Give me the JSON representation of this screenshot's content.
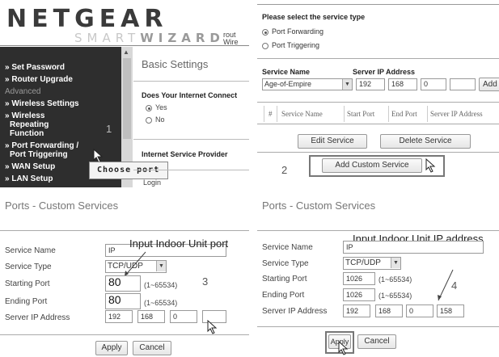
{
  "panel1": {
    "logo": "NETGEAR",
    "logo_sub_light": "SMART",
    "logo_sub_bold": "WIZARD",
    "logo_side_1": "rout",
    "logo_side_2": "Wire",
    "sidebar": {
      "items": [
        {
          "label": "» Set Password"
        },
        {
          "label": "» Router Upgrade"
        },
        {
          "label": "» Wireless Settings"
        },
        {
          "label": "» Wireless"
        },
        {
          "label": "Repeating"
        },
        {
          "label": "Function"
        },
        {
          "label": "» Port Forwarding /"
        },
        {
          "label": "Port Triggering"
        },
        {
          "label": "» WAN Setup"
        },
        {
          "label": "» LAN Setup"
        }
      ],
      "section_advanced": "Advanced"
    },
    "tooltip": "Choose port",
    "step_number": "1",
    "main": {
      "title": "Basic Settings",
      "question": "Does Your Internet Connect",
      "opt_yes": "Yes",
      "opt_no": "No",
      "isp_label": "Internet Service Provider",
      "login": "Login"
    }
  },
  "panel2": {
    "question": "Please select the service type",
    "opt_forwarding": "Port Forwarding",
    "opt_triggering": "Port Triggering",
    "service_name_label": "Service Name",
    "server_ip_label": "Server IP Address",
    "service_selected": "Age-of-Empire",
    "ip": [
      "192",
      "168",
      "0",
      ""
    ],
    "add_button": "Add",
    "table_headers": [
      "#",
      "Service Name",
      "Start Port",
      "End Port",
      "Server IP Address"
    ],
    "edit_button": "Edit Service",
    "delete_button": "Delete Service",
    "add_custom_button": "Add Custom Service",
    "step_number": "2"
  },
  "panel3": {
    "title": "Ports - Custom Services",
    "overlay": "Input Indoor Unit port",
    "fields": {
      "service_name_label": "Service Name",
      "service_name_value": "IP",
      "service_type_label": "Service Type",
      "service_type_value": "TCP/UDP",
      "starting_port_label": "Starting Port",
      "starting_port_value": "80",
      "ending_port_label": "Ending Port",
      "ending_port_value": "80",
      "range": "(1~65534)",
      "server_ip_label": "Server IP Address",
      "ip": [
        "192",
        "168",
        "0",
        ""
      ]
    },
    "step_number": "3",
    "apply_button": "Apply",
    "cancel_button": "Cancel"
  },
  "panel4": {
    "title": "Ports - Custom Services",
    "overlay": "Input Indoor Unit IP address",
    "fields": {
      "service_name_label": "Service Name",
      "service_name_value": "IP",
      "service_type_label": "Service Type",
      "service_type_value": "TCP/UDP",
      "starting_port_label": "Starting Port",
      "starting_port_value": "1026",
      "ending_port_label": "Ending Port",
      "ending_port_value": "1026",
      "range": "(1~65534)",
      "server_ip_label": "Server IP Address",
      "ip": [
        "192",
        "168",
        "0",
        "158"
      ]
    },
    "step_number": "4",
    "apply_button": "Apply",
    "cancel_button": "Cancel"
  }
}
